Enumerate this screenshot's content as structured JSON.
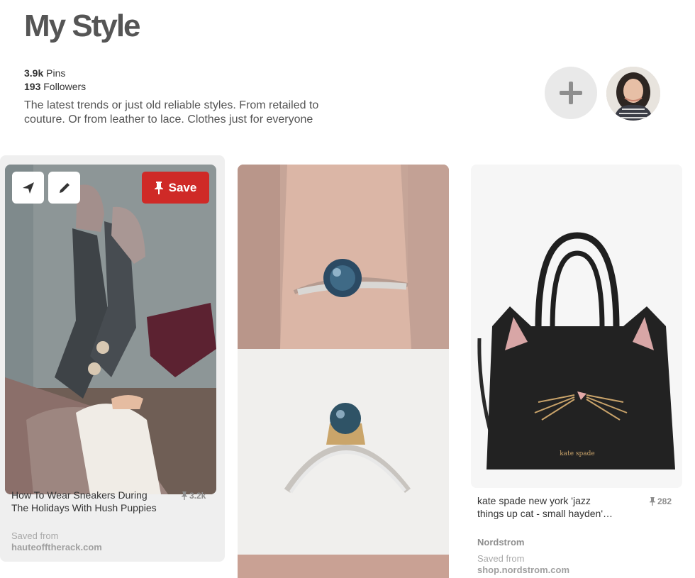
{
  "board": {
    "title": "My Style",
    "pins_count": "3.9k",
    "pins_label": "Pins",
    "followers_count": "193",
    "followers_label": "Followers",
    "description": "The latest trends or just old reliable styles. From retailed to couture. Or from leather to lace. Clothes just for everyone"
  },
  "actions": {
    "add_icon": "plus-icon",
    "avatar_icon": "user-avatar"
  },
  "pins": [
    {
      "title": "How To Wear Sneakers During The Holidays With Hush Puppies",
      "saves": "3.2k",
      "saved_from_label": "Saved from",
      "domain": "hauteofftherack.com",
      "send_icon": "send-icon",
      "edit_icon": "pencil-icon",
      "save_label": "Save",
      "save_icon": "pushpin-icon"
    },
    {
      "title": "",
      "image": "ring-photos"
    },
    {
      "title": "kate spade new york 'jazz things up cat - small hayden'…",
      "saves": "282",
      "source": "Nordstrom",
      "saved_from_label": "Saved from",
      "domain": "shop.nordstrom.com",
      "bag_brand": "kate spade"
    }
  ],
  "colors": {
    "save_button": "#cf2a27",
    "card_hover": "#efefef",
    "title": "#555555"
  }
}
